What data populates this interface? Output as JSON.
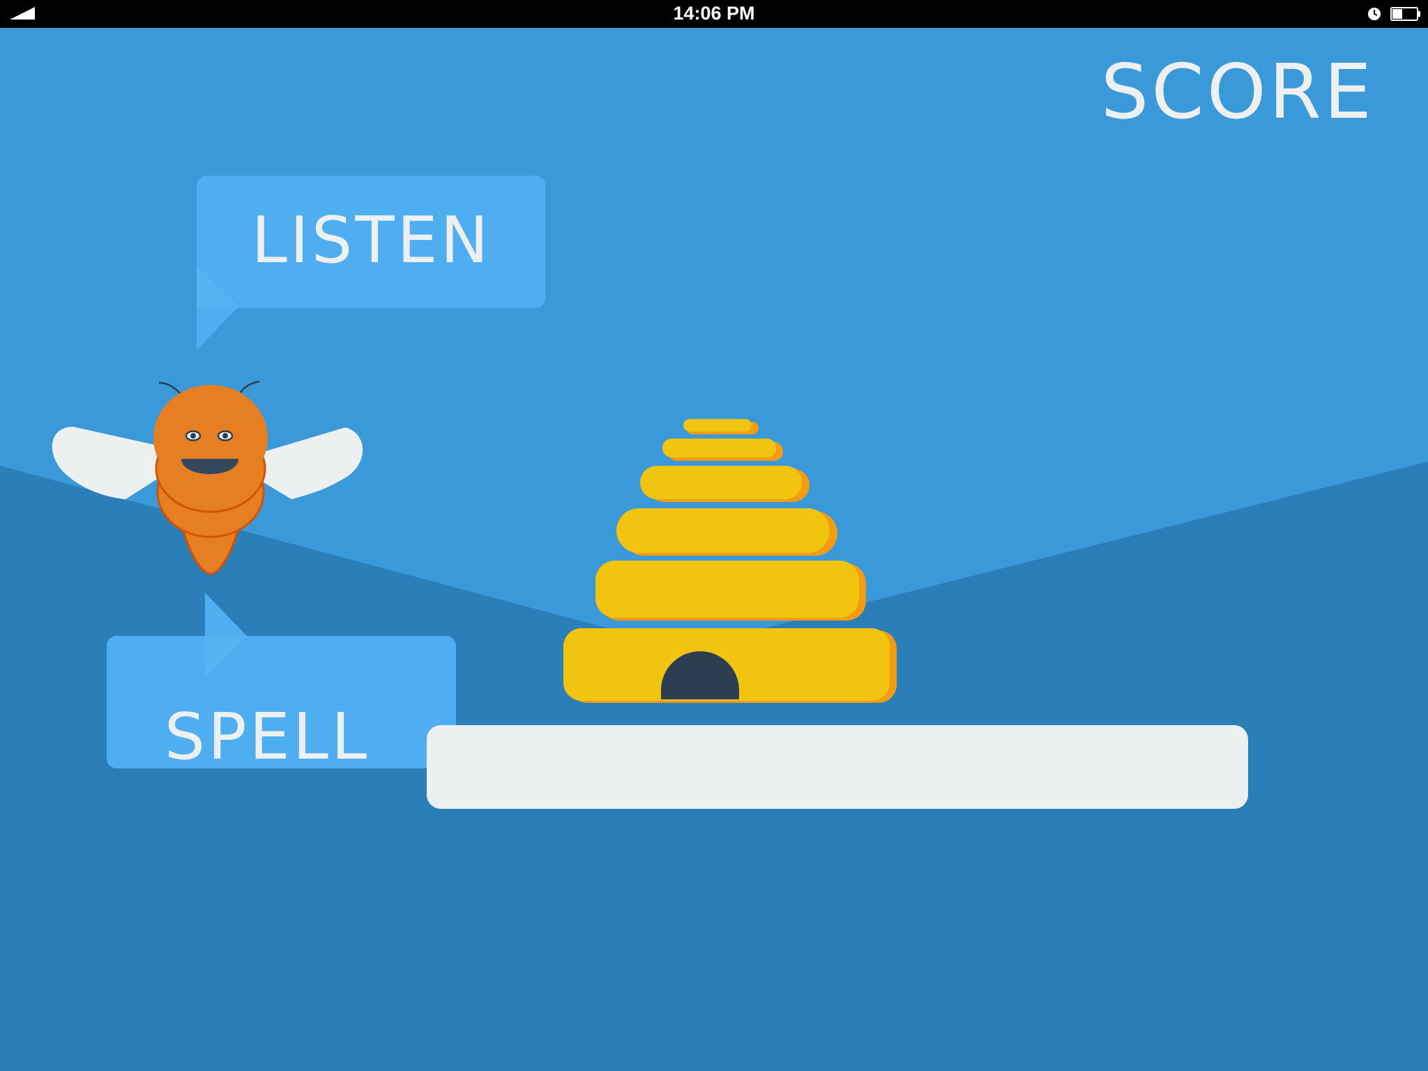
{
  "status_bar": {
    "time": "14:06 PM",
    "signal_icon": "signal-icon",
    "clock_icon": "clock-icon",
    "battery_icon": "battery-icon"
  },
  "score": {
    "label": "SCORE"
  },
  "prompts": {
    "listen": "LISTEN",
    "spell": "SPELL"
  },
  "answer": {
    "value": "",
    "placeholder": ""
  },
  "illustrations": {
    "mascot": "bee-mascot",
    "hive": "beehive"
  },
  "colors": {
    "sky": "#3a9ad9",
    "ground": "#2a7fb8",
    "bubble": "#4eaef0",
    "text": "#ecf0f1",
    "bee_body": "#e67e22",
    "hive": "#f1c40f",
    "hive_shadow": "#f39c12",
    "dark": "#2c3e50"
  }
}
